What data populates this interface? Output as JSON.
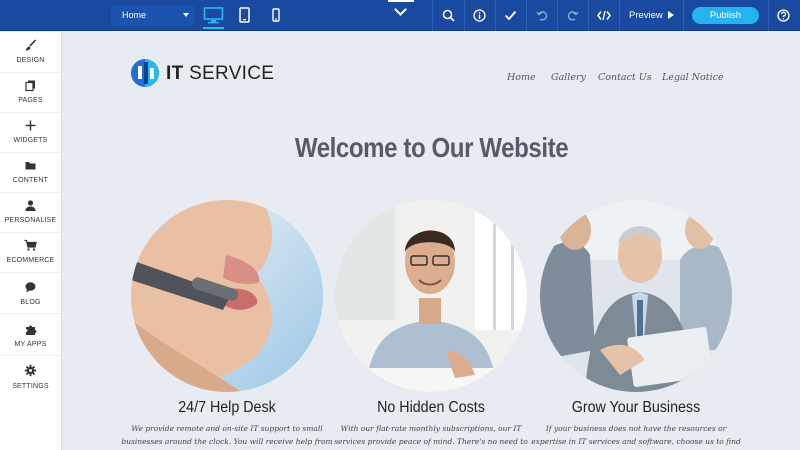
{
  "toolbar": {
    "page_select": "Home",
    "preview_label": "Preview",
    "publish_label": "Publish",
    "colors": {
      "bar": "#1a4aa0",
      "publish": "#26b2ee",
      "active_device": "#29b6f6"
    },
    "icons": [
      "desktop-icon",
      "tablet-icon",
      "phone-icon",
      "chevron-down-icon",
      "search-icon",
      "info-icon",
      "check-icon",
      "undo-icon",
      "redo-icon",
      "code-icon",
      "play-icon",
      "help-icon"
    ]
  },
  "sidebar": {
    "items": [
      {
        "label": "DESIGN",
        "icon": "brush-icon"
      },
      {
        "label": "PAGES",
        "icon": "pages-icon"
      },
      {
        "label": "WIDGETS",
        "icon": "plus-icon"
      },
      {
        "label": "CONTENT",
        "icon": "folder-icon"
      },
      {
        "label": "PERSONALISE",
        "icon": "person-icon"
      },
      {
        "label": "ECOMMERCE",
        "icon": "cart-icon"
      },
      {
        "label": "BLOG",
        "icon": "chat-bubble-icon"
      },
      {
        "label": "MY APPS",
        "icon": "puzzle-icon"
      },
      {
        "label": "SETTINGS",
        "icon": "gear-icon"
      }
    ]
  },
  "site": {
    "logo_bold": "IT",
    "logo_rest": " SERVICE",
    "nav": [
      "Home",
      "Gallery",
      "Contact Us",
      "Legal Notice"
    ],
    "headline": "Welcome to Our Website",
    "cards": [
      {
        "title": "24/7 Help Desk",
        "text": "We provide remote and on-site IT support to small businesses around the clock. You will receive help from us"
      },
      {
        "title": "No Hidden Costs",
        "text": "With our flat-rate monthly subscriptions, our IT services provide peace of mind. There's no need to worry about any"
      },
      {
        "title": "Grow Your Business",
        "text": "If your business does not have the resources or expertise in IT services and software, choose us to find the right solutions"
      }
    ]
  }
}
